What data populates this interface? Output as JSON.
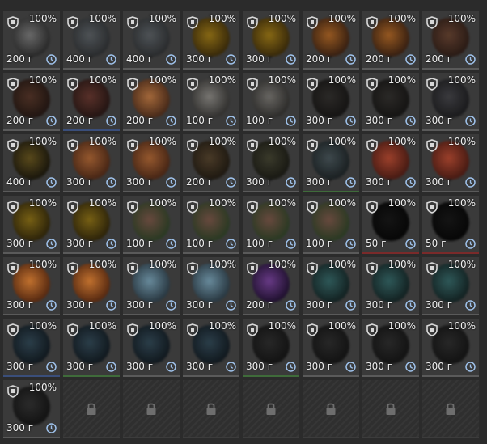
{
  "slots": [
    {
      "durability": "100%",
      "price": "200 г",
      "art": [
        "#6b6b6b",
        "#2a2a2a"
      ],
      "edge": ""
    },
    {
      "durability": "100%",
      "price": "400 г",
      "art": [
        "#4f5458",
        "#2a2c2e"
      ],
      "edge": ""
    },
    {
      "durability": "100%",
      "price": "400 г",
      "art": [
        "#4f5458",
        "#2a2c2e"
      ],
      "edge": ""
    },
    {
      "durability": "100%",
      "price": "300 г",
      "art": [
        "#8a6a12",
        "#3a2a08"
      ],
      "edge": ""
    },
    {
      "durability": "100%",
      "price": "300 г",
      "art": [
        "#8a6a12",
        "#3a2a08"
      ],
      "edge": ""
    },
    {
      "durability": "100%",
      "price": "200 г",
      "art": [
        "#9a5a20",
        "#3a2010"
      ],
      "edge": ""
    },
    {
      "durability": "100%",
      "price": "200 г",
      "art": [
        "#9a5a20",
        "#3a2010"
      ],
      "edge": ""
    },
    {
      "durability": "100%",
      "price": "200 г",
      "art": [
        "#5a3a2a",
        "#2a1a14"
      ],
      "edge": ""
    },
    {
      "durability": "100%",
      "price": "200 г",
      "art": [
        "#4a2e22",
        "#201410"
      ],
      "edge": ""
    },
    {
      "durability": "100%",
      "price": "200 г",
      "art": [
        "#5a3028",
        "#241412"
      ],
      "edge": "blue"
    },
    {
      "durability": "100%",
      "price": "200 г",
      "art": [
        "#a86a3a",
        "#4a2a18"
      ],
      "edge": ""
    },
    {
      "durability": "100%",
      "price": "100 г",
      "art": [
        "#7a7874",
        "#333230"
      ],
      "edge": ""
    },
    {
      "durability": "100%",
      "price": "100 г",
      "art": [
        "#6a6864",
        "#2e2d2b"
      ],
      "edge": ""
    },
    {
      "durability": "100%",
      "price": "300 г",
      "art": [
        "#2a2826",
        "#141312"
      ],
      "edge": ""
    },
    {
      "durability": "100%",
      "price": "300 г",
      "art": [
        "#2a2826",
        "#141312"
      ],
      "edge": ""
    },
    {
      "durability": "100%",
      "price": "300 г",
      "art": [
        "#3a3a3e",
        "#1a1a1c"
      ],
      "edge": ""
    },
    {
      "durability": "100%",
      "price": "400 г",
      "art": [
        "#5a4a1a",
        "#1a160a"
      ],
      "edge": ""
    },
    {
      "durability": "100%",
      "price": "300 г",
      "art": [
        "#9a5a2e",
        "#4a2614"
      ],
      "edge": ""
    },
    {
      "durability": "100%",
      "price": "300 г",
      "art": [
        "#9a5a2e",
        "#4a2614"
      ],
      "edge": ""
    },
    {
      "durability": "100%",
      "price": "200 г",
      "art": [
        "#4a3a26",
        "#1e1810"
      ],
      "edge": ""
    },
    {
      "durability": "100%",
      "price": "300 г",
      "art": [
        "#3a3a2a",
        "#181812"
      ],
      "edge": ""
    },
    {
      "durability": "100%",
      "price": "300 г",
      "art": [
        "#3e4a4e",
        "#1a2022"
      ],
      "edge": "green"
    },
    {
      "durability": "100%",
      "price": "300 г",
      "art": [
        "#a0402a",
        "#4a1a12"
      ],
      "edge": ""
    },
    {
      "durability": "100%",
      "price": "300 г",
      "art": [
        "#a0402a",
        "#4a1a12"
      ],
      "edge": ""
    },
    {
      "durability": "100%",
      "price": "300 г",
      "art": [
        "#7a6212",
        "#2e2408"
      ],
      "edge": ""
    },
    {
      "durability": "100%",
      "price": "300 г",
      "art": [
        "#7a6212",
        "#2e2408"
      ],
      "edge": ""
    },
    {
      "durability": "100%",
      "price": "100 г",
      "art": [
        "#6a4a3e",
        "#2a3a22"
      ],
      "edge": ""
    },
    {
      "durability": "100%",
      "price": "100 г",
      "art": [
        "#6a4a3e",
        "#2a3a22"
      ],
      "edge": ""
    },
    {
      "durability": "100%",
      "price": "100 г",
      "art": [
        "#6a4a3e",
        "#2a3a22"
      ],
      "edge": ""
    },
    {
      "durability": "100%",
      "price": "100 г",
      "art": [
        "#6a4a3e",
        "#2a3a22"
      ],
      "edge": ""
    },
    {
      "durability": "100%",
      "price": "50 г",
      "art": [
        "#121212",
        "#050505"
      ],
      "edge": "red"
    },
    {
      "durability": "100%",
      "price": "50 г",
      "art": [
        "#121212",
        "#050505"
      ],
      "edge": "red"
    },
    {
      "durability": "100%",
      "price": "300 г",
      "art": [
        "#c8742e",
        "#5a2a10"
      ],
      "edge": ""
    },
    {
      "durability": "100%",
      "price": "300 г",
      "art": [
        "#c8742e",
        "#5a2a10"
      ],
      "edge": ""
    },
    {
      "durability": "100%",
      "price": "300 г",
      "art": [
        "#6a8ea0",
        "#2a3a44"
      ],
      "edge": ""
    },
    {
      "durability": "100%",
      "price": "300 г",
      "art": [
        "#6a8ea0",
        "#2a3a44"
      ],
      "edge": ""
    },
    {
      "durability": "100%",
      "price": "200 г",
      "art": [
        "#6a3a8a",
        "#201030"
      ],
      "edge": ""
    },
    {
      "durability": "100%",
      "price": "300 г",
      "art": [
        "#2e5a5a",
        "#122222"
      ],
      "edge": ""
    },
    {
      "durability": "100%",
      "price": "300 г",
      "art": [
        "#2e5a5a",
        "#122222"
      ],
      "edge": ""
    },
    {
      "durability": "100%",
      "price": "300 г",
      "art": [
        "#2e5a5a",
        "#122222"
      ],
      "edge": ""
    },
    {
      "durability": "100%",
      "price": "300 г",
      "art": [
        "#2a3e4a",
        "#10181e"
      ],
      "edge": "blue"
    },
    {
      "durability": "100%",
      "price": "300 г",
      "art": [
        "#2a3e4a",
        "#10181e"
      ],
      "edge": "green"
    },
    {
      "durability": "100%",
      "price": "300 г",
      "art": [
        "#2a3e4a",
        "#10181e"
      ],
      "edge": ""
    },
    {
      "durability": "100%",
      "price": "300 г",
      "art": [
        "#2a3e4a",
        "#10181e"
      ],
      "edge": ""
    },
    {
      "durability": "100%",
      "price": "300 г",
      "art": [
        "#262626",
        "#121212"
      ],
      "edge": "green"
    },
    {
      "durability": "100%",
      "price": "300 г",
      "art": [
        "#262626",
        "#121212"
      ],
      "edge": ""
    },
    {
      "durability": "100%",
      "price": "300 г",
      "art": [
        "#262626",
        "#121212"
      ],
      "edge": ""
    },
    {
      "durability": "100%",
      "price": "300 г",
      "art": [
        "#262626",
        "#121212"
      ],
      "edge": ""
    },
    {
      "durability": "100%",
      "price": "300 г",
      "art": [
        "#2a2a2a",
        "#121212"
      ],
      "edge": ""
    }
  ],
  "locked_slots": 7
}
